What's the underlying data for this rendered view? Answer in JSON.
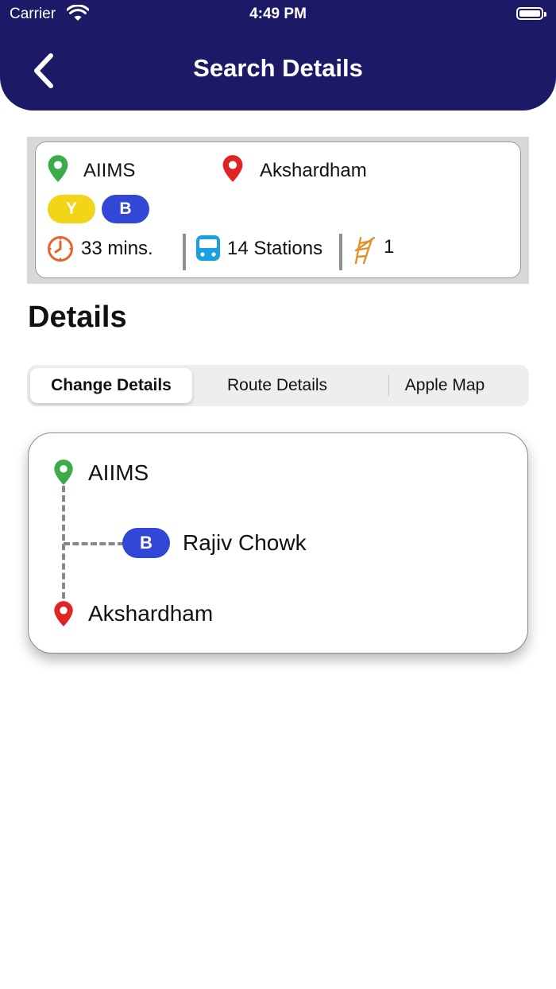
{
  "status_bar": {
    "carrier": "Carrier",
    "time": "4:49 PM"
  },
  "header": {
    "title": "Search Details"
  },
  "summary": {
    "from_station": "AIIMS",
    "to_station": "Akshardham",
    "lines": [
      {
        "code": "Y",
        "color": "#f2d419"
      },
      {
        "code": "B",
        "color": "#3347d6"
      }
    ],
    "duration": "33 mins.",
    "stations": "14 Stations",
    "interchanges": "1"
  },
  "details": {
    "heading": "Details",
    "tabs": [
      {
        "label": "Change Details",
        "active": true
      },
      {
        "label": "Route Details",
        "active": false
      },
      {
        "label": "Apple Map",
        "active": false
      }
    ]
  },
  "route": {
    "start": "AIIMS",
    "change": {
      "line": "B",
      "station": "Rajiv Chowk"
    },
    "end": "Akshardham"
  },
  "colors": {
    "header_bg": "#1c1a66",
    "origin_pin": "#3aad4a",
    "destination_pin": "#e02424",
    "clock_icon": "#e8632a",
    "train_icon": "#1a9fe0",
    "interchange_icon": "#e0922a"
  },
  "icons": [
    "back-chevron-icon",
    "wifi-icon",
    "battery-icon",
    "location-pin-icon",
    "clock-icon",
    "train-icon",
    "interchange-icon"
  ]
}
